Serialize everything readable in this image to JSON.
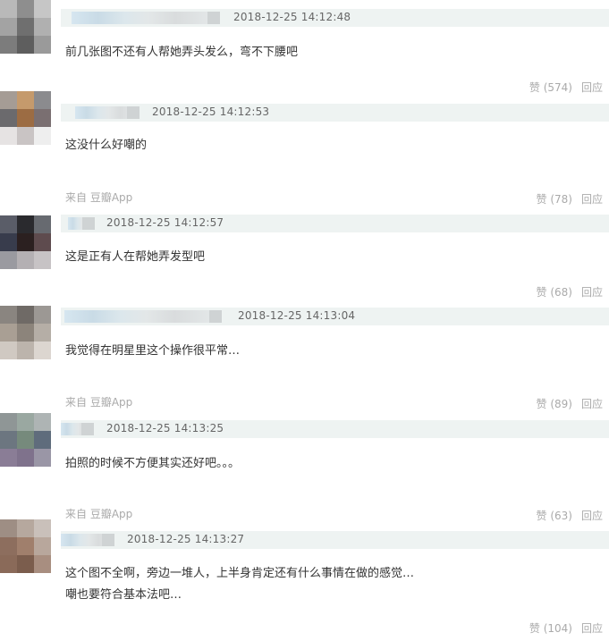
{
  "comments": [
    {
      "time": "2018-12-25 14:12:48",
      "lines": [
        "前几张图不还有人帮她弄头发么，弯不下腰吧"
      ],
      "source": "",
      "like_label": "赞 (574)",
      "reply_label": "回应"
    },
    {
      "time": "2018-12-25 14:12:53",
      "lines": [
        "这没什么好嘲的"
      ],
      "source": "来自 豆瓣App",
      "like_label": "赞 (78)",
      "reply_label": "回应"
    },
    {
      "time": "2018-12-25 14:12:57",
      "lines": [
        "这是正有人在帮她弄发型吧"
      ],
      "source": "",
      "like_label": "赞 (68)",
      "reply_label": "回应"
    },
    {
      "time": "2018-12-25 14:13:04",
      "lines": [
        "我觉得在明星里这个操作很平常…"
      ],
      "source": "来自 豆瓣App",
      "like_label": "赞 (89)",
      "reply_label": "回应"
    },
    {
      "time": "2018-12-25 14:13:25",
      "lines": [
        "拍照的时候不方便其实还好吧。。。"
      ],
      "source": "来自 豆瓣App",
      "like_label": "赞 (63)",
      "reply_label": "回应"
    },
    {
      "time": "2018-12-25 14:13:27",
      "lines": [
        "这个图不全啊，旁边一堆人，上半身肯定还有什么事情在做的感觉…",
        "嘲也要符合基本法吧…"
      ],
      "source": "",
      "like_label": "赞 (104)",
      "reply_label": "回应"
    }
  ]
}
